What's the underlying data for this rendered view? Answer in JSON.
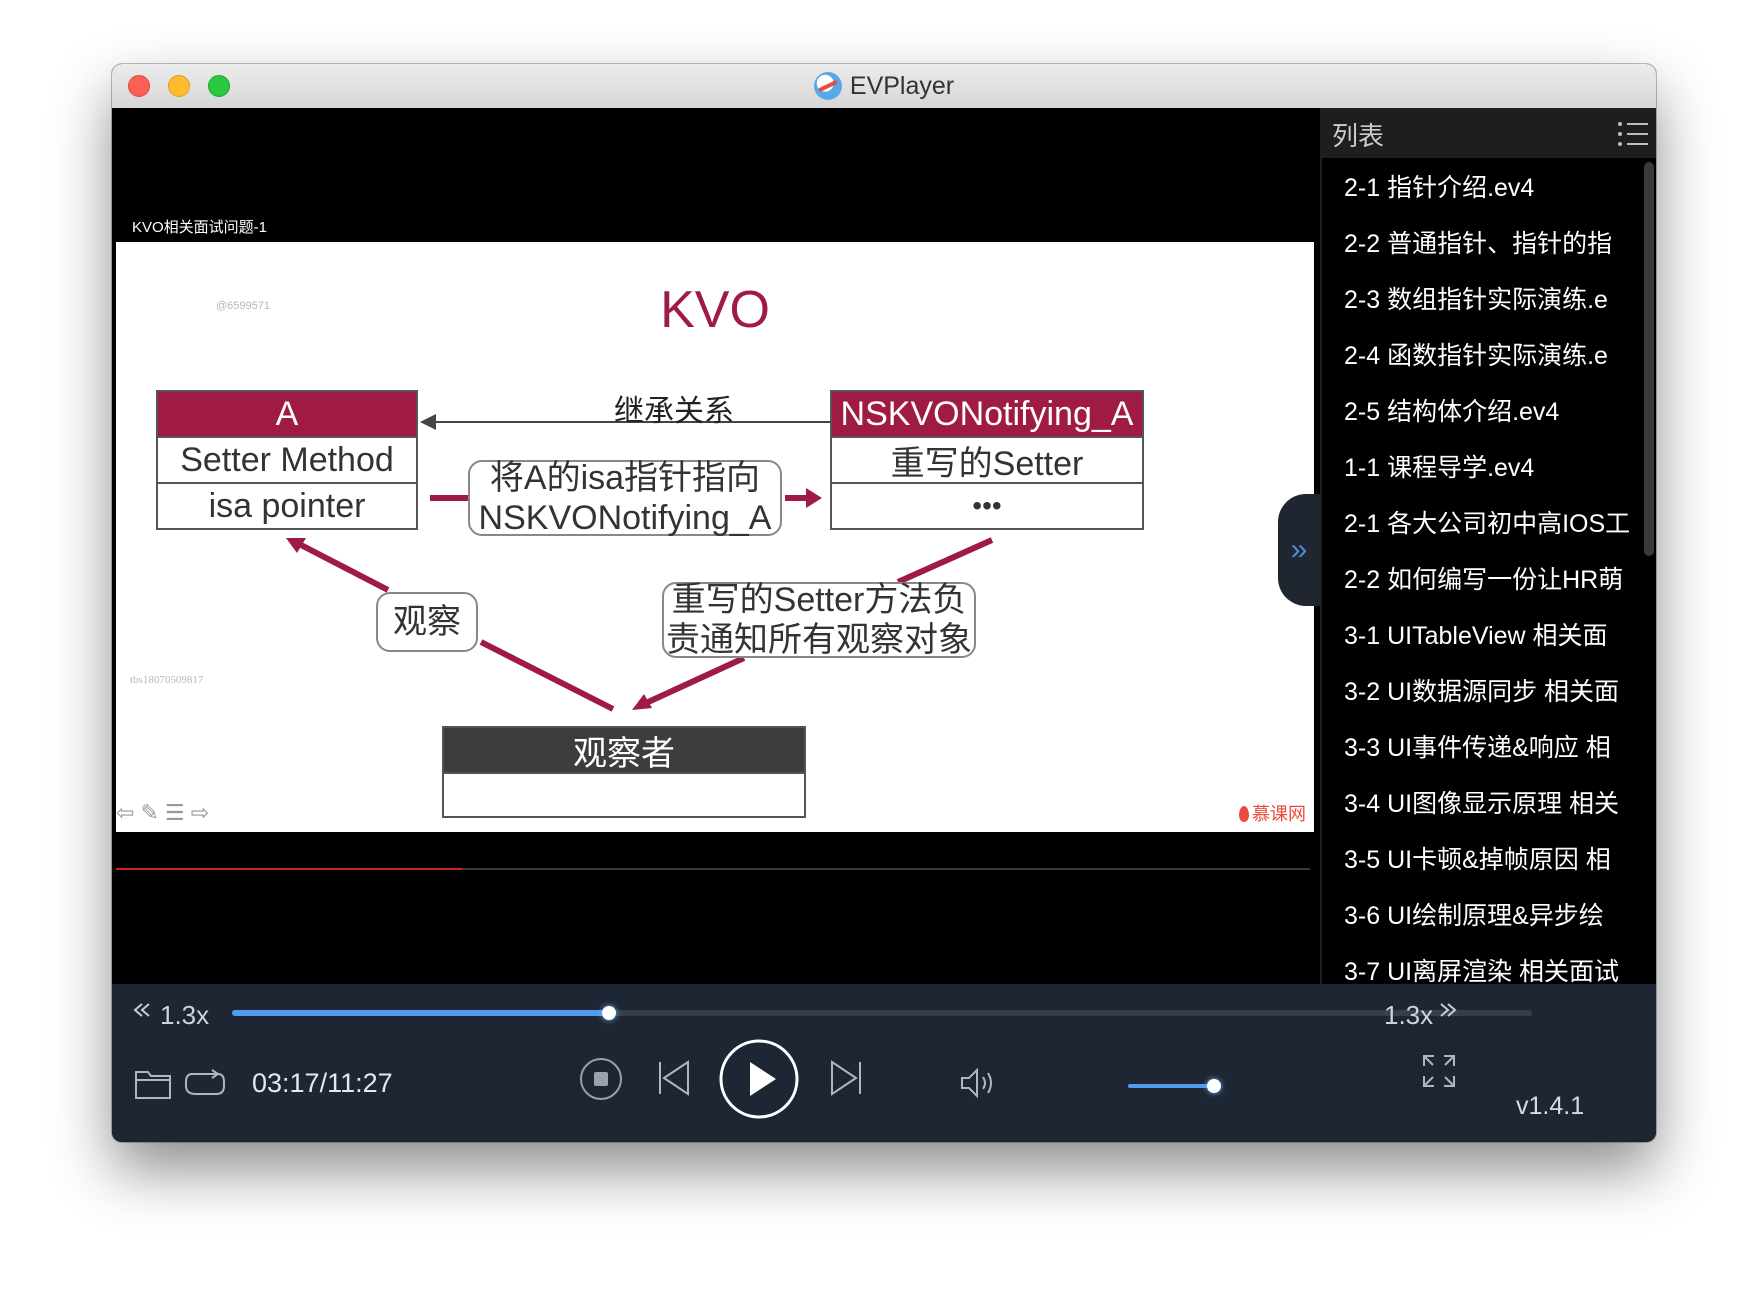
{
  "window": {
    "title": "EVPlayer"
  },
  "video": {
    "caption": "KVO相关面试问题-1",
    "progress_fraction": 0.29,
    "slide": {
      "watermark_top": "@6599571",
      "watermark_left": "tbs18070509817",
      "title": "KVO",
      "box_a": {
        "head": "A",
        "rows": [
          "Setter Method",
          "isa pointer"
        ]
      },
      "box_nskvo": {
        "head": "NSKVONotifying_A",
        "rows": [
          "重写的Setter",
          "•••"
        ]
      },
      "inheritance_label": "继承关系",
      "isa_bubble": [
        "将A的isa指针指向",
        "NSKVONotifying_A"
      ],
      "observe_bubble": "观察",
      "setter_bubble": [
        "重写的Setter方法负",
        "责通知所有观察对象"
      ],
      "observer_box": {
        "head": "观察者"
      },
      "brand": "慕课网"
    }
  },
  "sidebar": {
    "title": "列表",
    "items": [
      "2-1 指针介绍.ev4",
      "2-2 普通指针、指针的指",
      "2-3 数组指针实际演练.e",
      "2-4 函数指针实际演练.e",
      "2-5 结构体介绍.ev4",
      "1-1 课程导学.ev4",
      "2-1 各大公司初中高IOS工",
      "2-2 如何编写一份让HR萌",
      "3-1 UITableView 相关面",
      "3-2 UI数据源同步 相关面",
      "3-3 UI事件传递&响应 相",
      "3-4 UI图像显示原理 相关",
      "3-5 UI卡顿&掉帧原因 相",
      "3-6 UI绘制原理&异步绘",
      "3-7 UI离屏渲染 相关面试"
    ]
  },
  "controls": {
    "speed_left": "1.3x",
    "speed_right": "1.3x",
    "seek_fraction": 0.29,
    "time": "03:17/11:27",
    "volume_fraction": 0.95,
    "version": "v1.4.1",
    "icons": [
      "rewind-speed-icon",
      "forward-speed-icon",
      "folder-icon",
      "loop-icon",
      "stop-icon",
      "previous-icon",
      "play-icon",
      "next-icon",
      "volume-icon",
      "fullscreen-icon"
    ]
  },
  "colors": {
    "accent": "#a01b43",
    "control_bg": "#1e2633",
    "progress": "#4f9cf0"
  }
}
